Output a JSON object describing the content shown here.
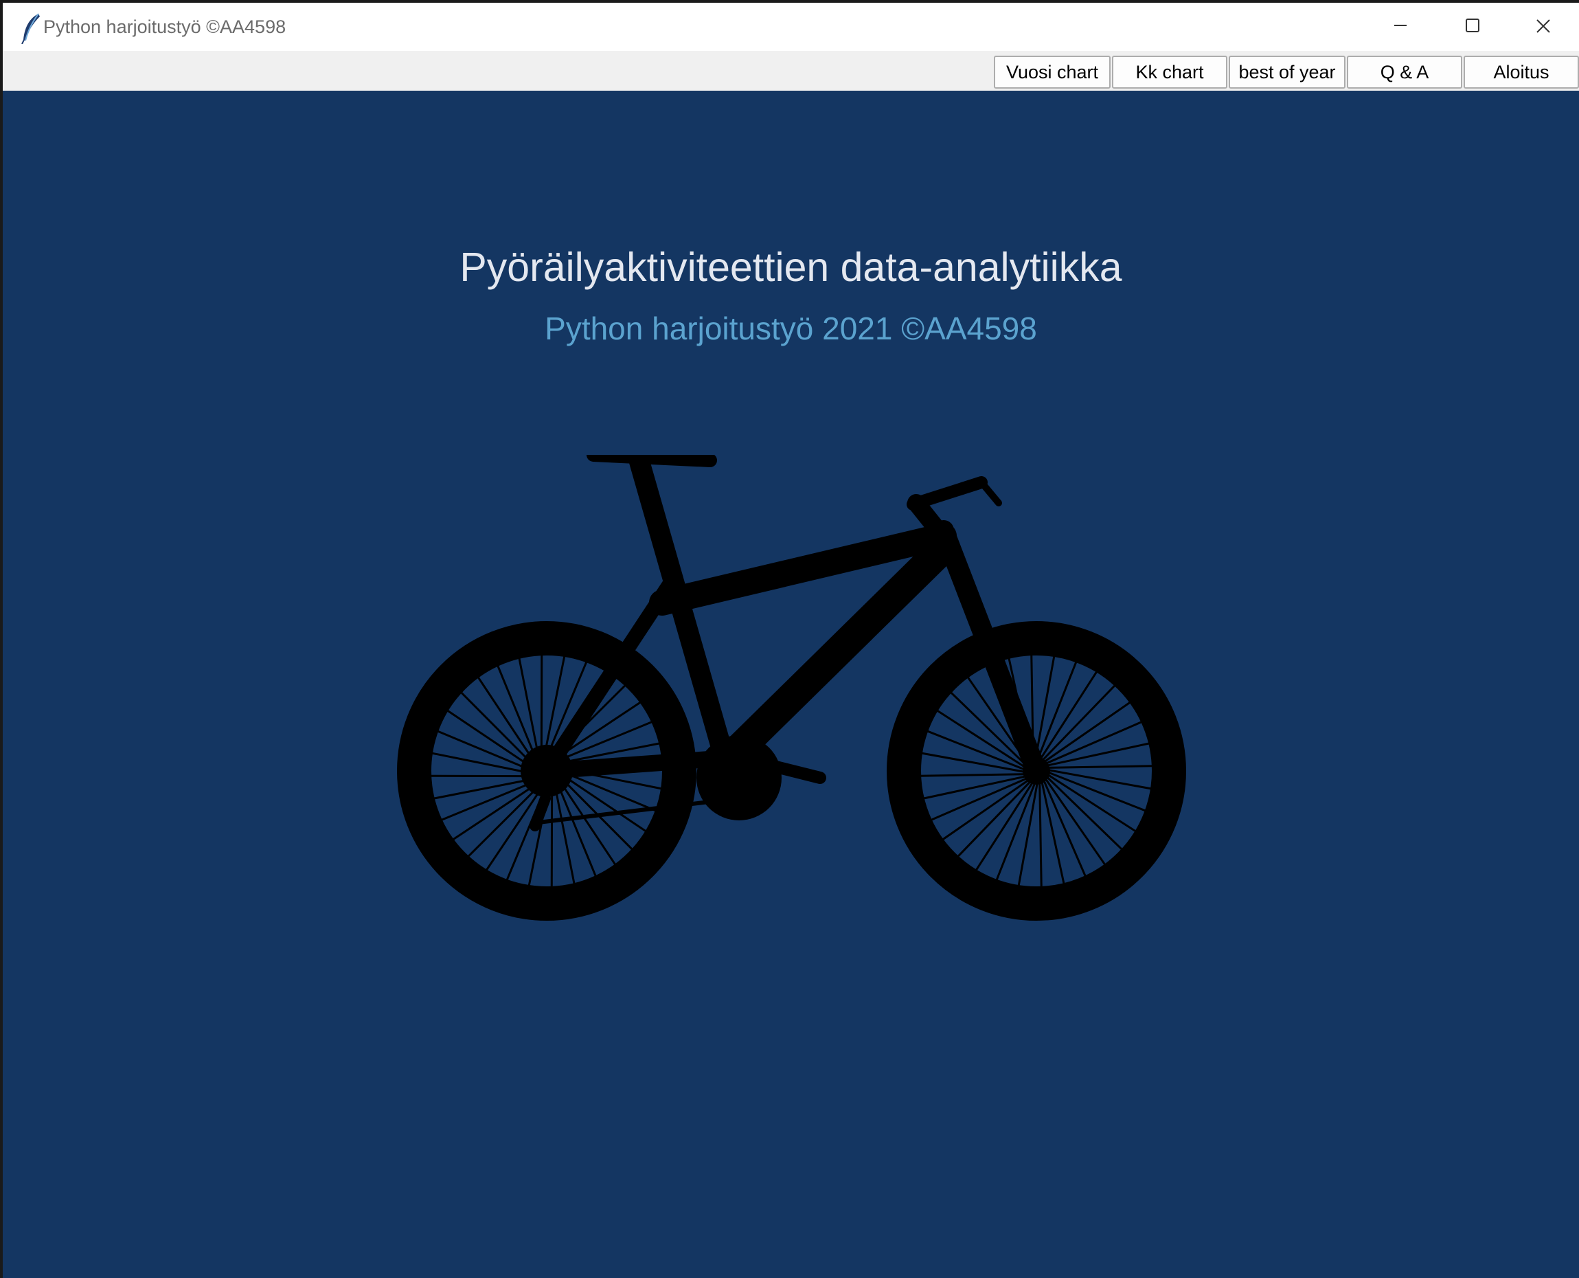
{
  "window": {
    "title": "Python harjoitustyö ©AA4598",
    "app_icon": "feather-icon",
    "controls": {
      "minimize_icon": "minimize-icon",
      "maximize_icon": "maximize-icon",
      "close_icon": "close-icon"
    }
  },
  "toolbar": {
    "buttons": [
      {
        "label": "Vuosi chart"
      },
      {
        "label": "Kk chart"
      },
      {
        "label": "best of year"
      },
      {
        "label": "Q & A"
      },
      {
        "label": "Aloitus"
      }
    ]
  },
  "main": {
    "title": "Pyöräilyaktiviteettien data-analytiikka",
    "subtitle": "Python harjoitustyö 2021 ©AA4598",
    "image_icon": "bicycle-silhouette"
  },
  "colors": {
    "background": "#143662",
    "title": "#e4e8f0",
    "subtitle": "#5ba3cf",
    "toolbar": "#f0f0f0",
    "silhouette": "#000000"
  }
}
